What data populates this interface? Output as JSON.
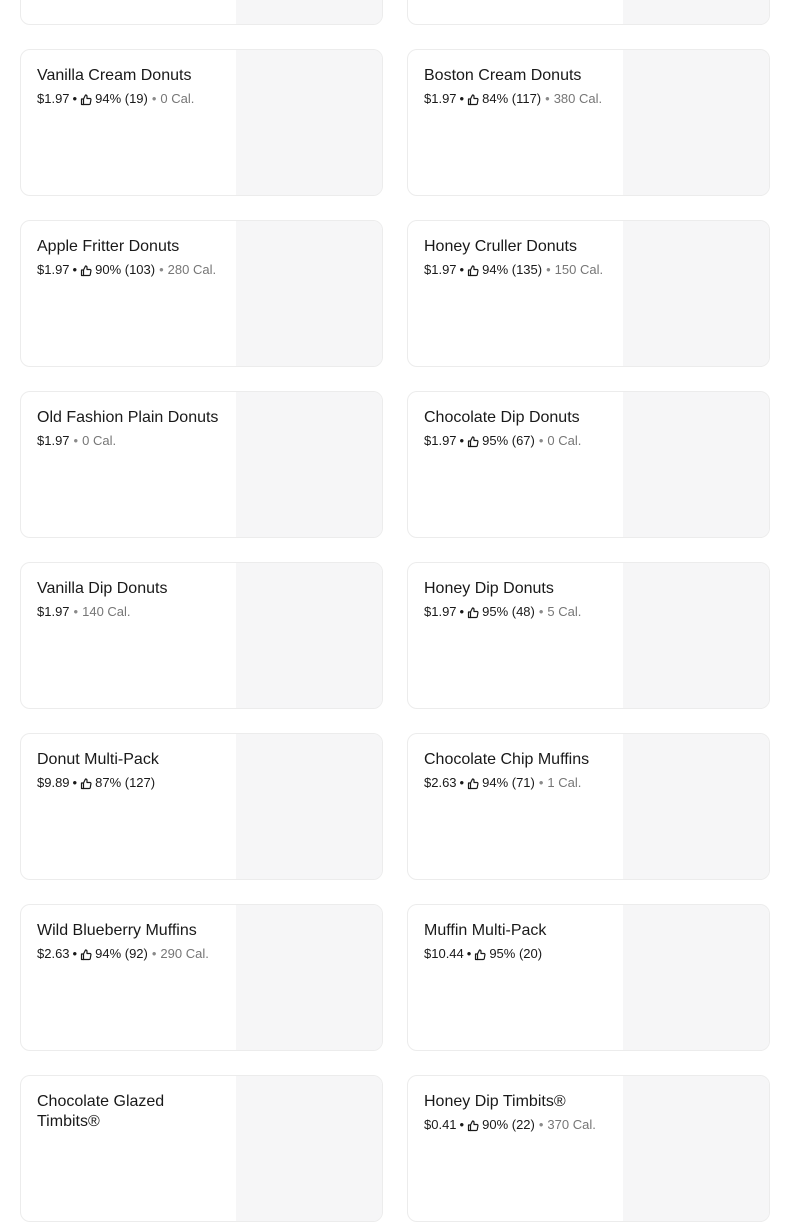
{
  "menu_items": [
    {
      "name": "",
      "price": "",
      "rating": "",
      "calories": ""
    },
    {
      "name": "",
      "price": "",
      "rating": "",
      "calories": ""
    },
    {
      "name": "Vanilla Cream Donuts",
      "price": "$1.97",
      "rating": "94% (19)",
      "calories": "0 Cal."
    },
    {
      "name": "Boston Cream Donuts",
      "price": "$1.97",
      "rating": "84% (117)",
      "calories": "380 Cal."
    },
    {
      "name": "Apple Fritter Donuts",
      "price": "$1.97",
      "rating": "90% (103)",
      "calories": "280 Cal."
    },
    {
      "name": "Honey Cruller Donuts",
      "price": "$1.97",
      "rating": "94% (135)",
      "calories": "150 Cal."
    },
    {
      "name": "Old Fashion Plain Donuts",
      "price": "$1.97",
      "rating": "",
      "calories": "0 Cal."
    },
    {
      "name": "Chocolate Dip Donuts",
      "price": "$1.97",
      "rating": "95% (67)",
      "calories": "0 Cal."
    },
    {
      "name": "Vanilla Dip Donuts",
      "price": "$1.97",
      "rating": "",
      "calories": "140 Cal."
    },
    {
      "name": "Honey Dip Donuts",
      "price": "$1.97",
      "rating": "95% (48)",
      "calories": "5 Cal."
    },
    {
      "name": "Donut Multi-Pack",
      "price": "$9.89",
      "rating": "87% (127)",
      "calories": ""
    },
    {
      "name": "Chocolate Chip Muffins",
      "price": "$2.63",
      "rating": "94% (71)",
      "calories": "1 Cal."
    },
    {
      "name": "Wild Blueberry Muffins",
      "price": "$2.63",
      "rating": "94% (92)",
      "calories": "290 Cal."
    },
    {
      "name": "Muffin Multi-Pack",
      "price": "$10.44",
      "rating": "95% (20)",
      "calories": ""
    },
    {
      "name": "Chocolate Glazed Timbits®",
      "price": "",
      "rating": "",
      "calories": ""
    },
    {
      "name": "Honey Dip Timbits®",
      "price": "$0.41",
      "rating": "90% (22)",
      "calories": "370 Cal."
    }
  ],
  "icons": {
    "rating": "thumbs-up-icon"
  }
}
